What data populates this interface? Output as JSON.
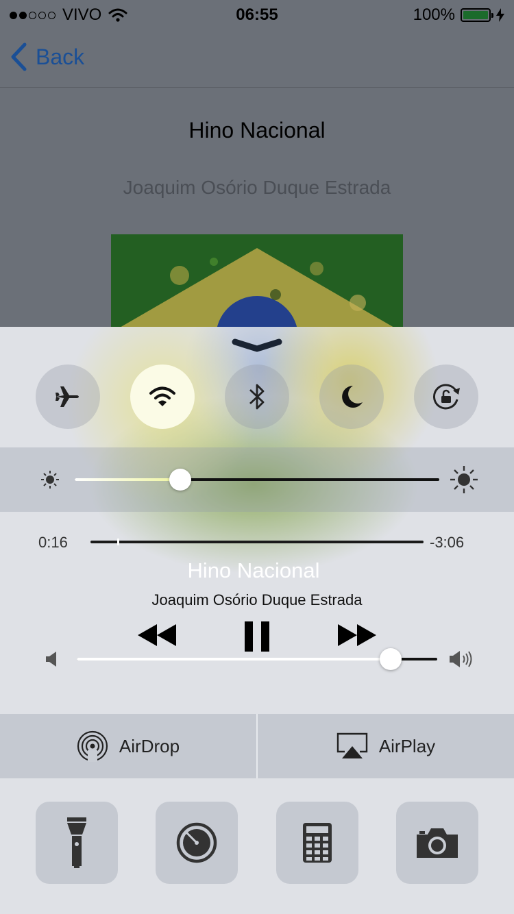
{
  "status_bar": {
    "carrier": "VIVO",
    "time": "06:55",
    "battery": "100%",
    "signal_bars_filled": 2,
    "signal_bars_total": 5
  },
  "nav": {
    "back_label": "Back"
  },
  "song": {
    "title": "Hino Nacional",
    "artist": "Joaquim Osório Duque Estrada"
  },
  "control_center": {
    "toggles": [
      {
        "name": "airplane-mode",
        "icon": "airplane-icon",
        "active": false
      },
      {
        "name": "wifi",
        "icon": "wifi-icon",
        "active": true
      },
      {
        "name": "bluetooth",
        "icon": "bluetooth-icon",
        "active": false
      },
      {
        "name": "do-not-disturb",
        "icon": "moon-icon",
        "active": false
      },
      {
        "name": "rotation-lock",
        "icon": "rotation-lock-icon",
        "active": false
      }
    ],
    "brightness_level": 0.29,
    "now_playing": {
      "elapsed": "0:16",
      "remaining": "-3:06",
      "progress": 0.08,
      "title": "Hino Nacional",
      "artist": "Joaquim Osório Duque Estrada",
      "state": "playing"
    },
    "volume_level": 0.87,
    "airdrop_label": "AirDrop",
    "airplay_label": "AirPlay",
    "tools": [
      "flashlight-icon",
      "timer-icon",
      "calculator-icon",
      "camera-icon"
    ]
  },
  "colors": {
    "accent_link": "#1a4f96",
    "battery_fill": "#1b6b2b",
    "wifi_active_bg": "#fbfbe6"
  }
}
